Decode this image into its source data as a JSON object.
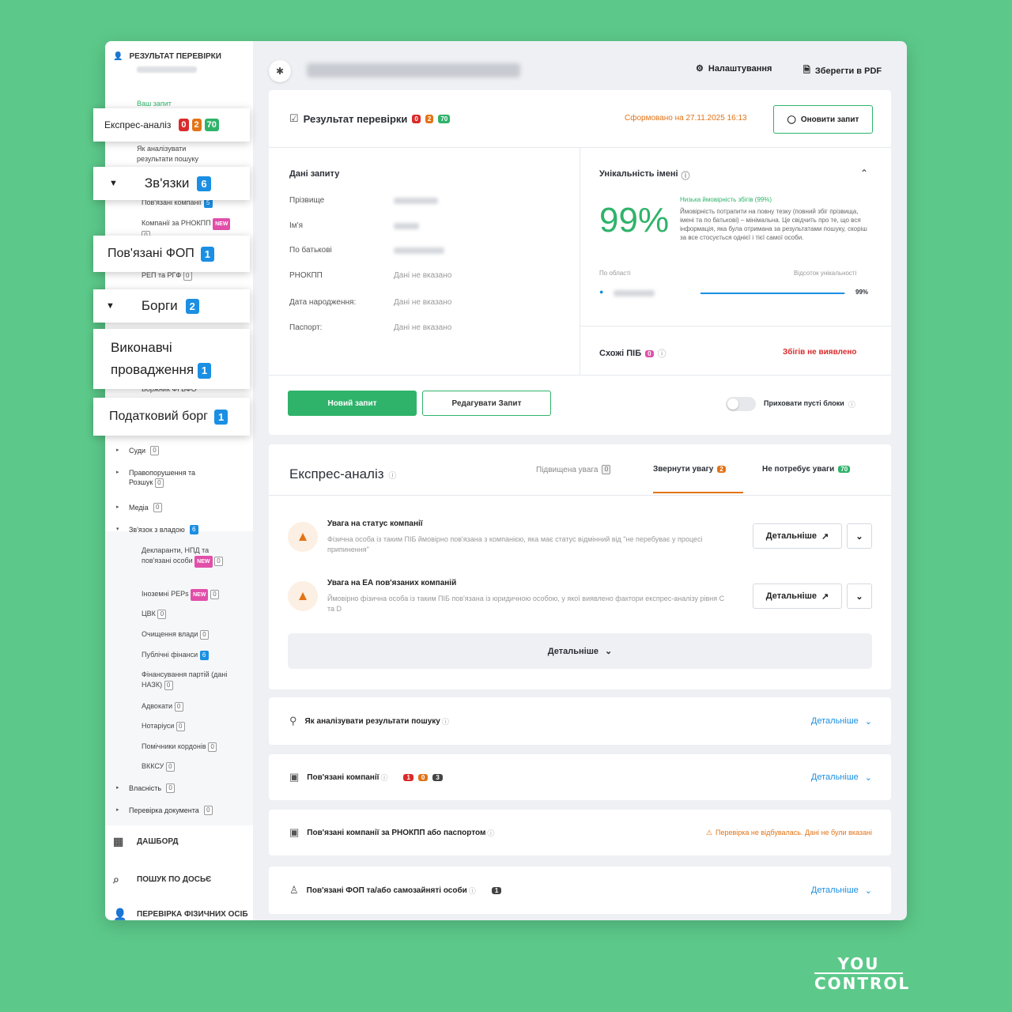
{
  "sidebar": {
    "header": "РЕЗУЛЬТАТ ПЕРЕВІРКИ",
    "your_request": "Ваш запит",
    "how_to_analyze": "Як аналізувати результати пошуку",
    "related_companies_sub": "Пов'язані компанії",
    "related_companies_sub_count": "5",
    "companies_by": "Компанії за РНОКПП",
    "new_label": "NEW",
    "companies_by_count": "0",
    "pep_label": "РЕП та РГФ",
    "pep_count": "0",
    "fop_sub": "Боржник ФГВФО",
    "courts": "Суди",
    "courts_count": "0",
    "law": "Правопорушення та Розшук",
    "law_count": "0",
    "media": "Медіа",
    "media_count": "0",
    "power": "Зв'язок з владою",
    "power_count": "6",
    "declarants": "Декларанти, НПД та пов'язані особи",
    "declarants_count": "0",
    "foreign_peps": "Іноземні PEPs",
    "foreign_peps_count": "0",
    "cvk": "ЦВК",
    "cvk_count": "0",
    "lustration": "Очищення влади",
    "lustration_count": "0",
    "public_finance": "Публічні фінанси",
    "public_finance_count": "6",
    "party_finance": "Фінансування партій (дані НАЗК)",
    "party_finance_count": "0",
    "lawyers": "Адвокати",
    "lawyers_count": "0",
    "notaries": "Нотаріуси",
    "notaries_count": "0",
    "border": "Помічники кордонів",
    "border_count": "0",
    "vkksu": "ВККСУ",
    "vkksu_count": "0",
    "property": "Власність",
    "property_count": "0",
    "doc_check": "Перевірка документа",
    "doc_check_count": "0",
    "nav_dashboard": "ДАШБОРД",
    "nav_dossier": "ПОШУК ПО ДОСЬЄ",
    "nav_persons": "ПЕРЕВІРКА ФІЗИЧНИХ ОСІБ"
  },
  "popups": {
    "express": {
      "label": "Експрес-аналіз",
      "red": "0",
      "orange": "2",
      "green": "70"
    },
    "links": {
      "label": "Зв'язки",
      "count": "6"
    },
    "fop": {
      "label": "Пов'язані ФОП",
      "count": "1"
    },
    "debts": {
      "label": "Борги",
      "count": "2"
    },
    "enforcement": {
      "line1": "Виконавчі",
      "line2": "провадження",
      "count": "1"
    },
    "tax": {
      "label": "Податковий борг",
      "count": "1"
    }
  },
  "topbar": {
    "settings": "Налаштування",
    "pdf": "Зберегти в PDF"
  },
  "result": {
    "title": "Результат перевірки",
    "red": "0",
    "orange": "2",
    "green": "70",
    "formed": "Сформовано на 27.11.2025 16:13",
    "refresh": "Оновити запит"
  },
  "request": {
    "title": "Дані запиту",
    "surname": "Прізвище",
    "name": "Ім'я",
    "patronymic": "По батькові",
    "rnokpp": "РНОКПП",
    "birth": "Дата народження:",
    "passport": "Паспорт:",
    "not_specified": "Дані не вказано"
  },
  "uniq": {
    "title": "Унікальність імені",
    "percent": "99%",
    "low": "Низька ймовірність збігів (99%)",
    "desc": "Ймовірність потрапити на повну тезку (повний збіг прізвища, імені та по батькові) – мінімальна. Це свідчить про те, що вся інформація, яка була отримана за результатами пошуку, скоріш за все стосується однієї і тієї самої особи.",
    "by_region": "По області",
    "pct_label": "Відсоток унікальності",
    "region_pct": "99%",
    "region_fill": 0.99,
    "similar": "Схожі ПІБ",
    "similar_count": "0",
    "no_match": "Збігів не виявлено"
  },
  "actions": {
    "new": "Новий запит",
    "edit": "Редагувати Запит",
    "hide_empty": "Приховати пусті блоки"
  },
  "express": {
    "title": "Експрес-аналіз",
    "tab_high": "Підвищена увага",
    "tab_high_count": "0",
    "tab_attention": "Звернути увагу",
    "tab_attention_count": "2",
    "tab_none": "Не потребує уваги",
    "tab_none_count": "70",
    "items": [
      {
        "title": "Увага на статус компанії",
        "desc": "Фізична особа із таким ПІБ ймовірно пов'язана з компанією, яка має статус відмінний від \"не перебуває у процесі припинення\""
      },
      {
        "title": "Увага на ЕА пов'язаних компаній",
        "desc": "Ймовірно фізична особа із таким ПІБ пов'язана із юридичною особою, у якої виявлено фактори експрес-аналізу рівня С та D"
      }
    ],
    "details": "Детальніше",
    "more": "Детальніше"
  },
  "sections": [
    {
      "title": "Як аналізувати результати пошуку",
      "action": "Детальніше"
    },
    {
      "title": "Пов'язані компанії",
      "action": "Детальніше",
      "r": "1",
      "o": "0",
      "d": "3"
    },
    {
      "title": "Пов'язані компанії за РНОКПП або паспортом",
      "warning": "Перевірка не відбувалась. Дані не були вказані"
    },
    {
      "title": "Пов'язані ФОП та/або самозайняті особи",
      "action": "Детальніше",
      "d": "1"
    }
  ],
  "logo": {
    "top": "YOU",
    "bottom": "CONTROL"
  },
  "colors": {
    "accent": "#2fb36a",
    "red": "#d92b2b",
    "orange": "#e27317",
    "blue": "#1a8fe3",
    "background": "#5cc98a"
  }
}
